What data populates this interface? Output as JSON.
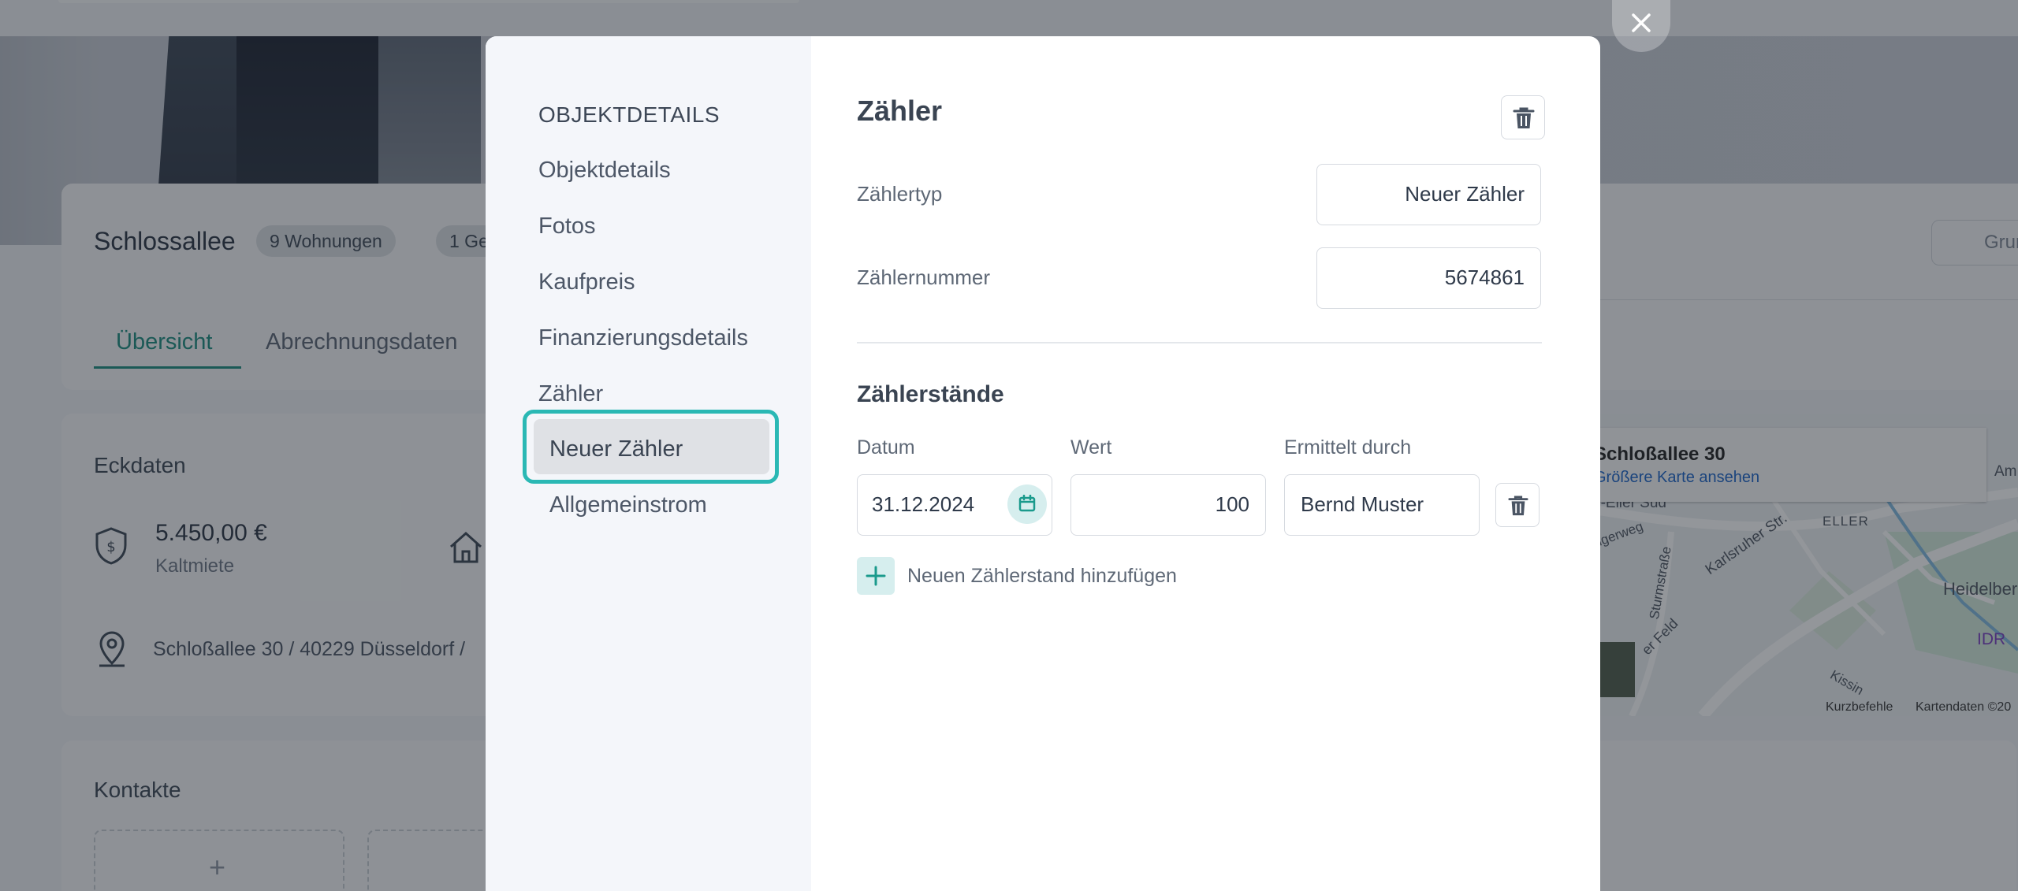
{
  "background": {
    "title": "Schlossallee",
    "chips": [
      "9 Wohnungen",
      "1 Ge"
    ],
    "tabs": [
      "Übersicht",
      "Abrechnungsdaten"
    ],
    "right_button": "Grunds",
    "eckdaten": {
      "title": "Eckdaten",
      "amount": "5.450,00 €",
      "amount_label": "Kaltmiete",
      "address": "Schloßallee 30 / 40229 Düsseldorf /"
    },
    "kontakte": {
      "title": "Kontakte",
      "add_symbol": "+"
    },
    "map": {
      "info_title": "Schloßallee 30",
      "info_link": "Größere Karte ansehen",
      "labels": [
        "n-Eller Süd",
        "ELLER",
        "Karlsruher Str.",
        "Heidelber",
        "IDR",
        "Sturmstraße",
        "igerweg",
        "er Feld",
        "Kissin",
        "Am All"
      ],
      "footer_left": "Kurzbefehle",
      "footer_right": "Kartendaten ©20"
    },
    "colors": {
      "accent": "#1a8a7d"
    }
  },
  "modal": {
    "nav": {
      "heading": "OBJEKTDETAILS",
      "items": [
        "Objektdetails",
        "Fotos",
        "Kaufpreis",
        "Finanzierungsdetails",
        "Zähler"
      ],
      "sub_items": [
        "Neuer Zähler",
        "Allgemeinstrom"
      ],
      "selected": "Neuer Zähler",
      "highlight_color": "#2ab8b4"
    },
    "content": {
      "title": "Zähler",
      "fields": {
        "type_label": "Zählertyp",
        "type_value": "Neuer Zähler",
        "number_label": "Zählernummer",
        "number_value": "5674861"
      },
      "readings": {
        "title": "Zählerstände",
        "col_date": "Datum",
        "col_value": "Wert",
        "col_by": "Ermittelt durch",
        "rows": [
          {
            "date": "31.12.2024",
            "value": "100",
            "by": "Bernd Muster"
          }
        ],
        "add_label": "Neuen Zählerstand hinzufügen"
      },
      "icons": [
        "trash-icon",
        "calendar-icon",
        "plus-icon",
        "close-icon"
      ]
    }
  }
}
